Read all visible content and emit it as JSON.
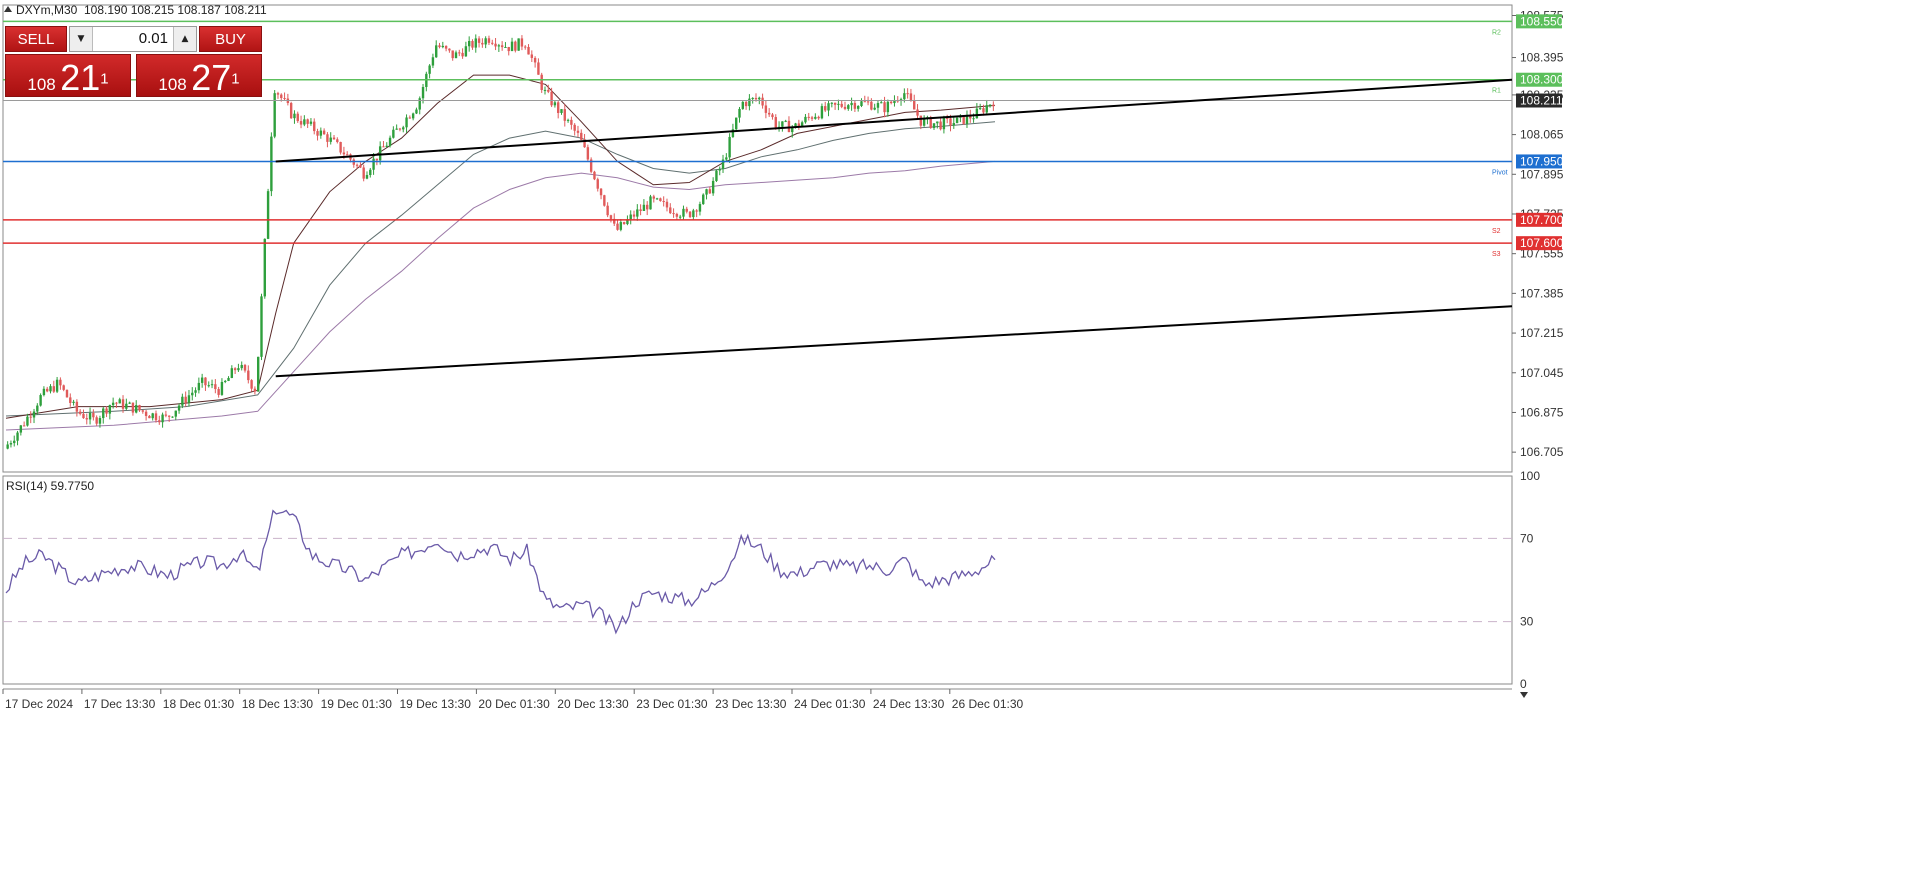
{
  "header": {
    "symbol_text": "DXYm,M30",
    "ohlc_text": "108.190 108.215 108.187 108.211"
  },
  "trade_panel": {
    "sell_label": "SELL",
    "buy_label": "BUY",
    "lot_value": "0.01",
    "sell_price": {
      "prefix": "108",
      "big": "21",
      "sup": "1"
    },
    "buy_price": {
      "prefix": "108",
      "big": "27",
      "sup": "1"
    }
  },
  "colors": {
    "bull": "#2e9f3c",
    "bear": "#e05a5a",
    "level_green": "#5cbf5c",
    "level_blue": "#1e6fd0",
    "level_red": "#e03030",
    "ma_dark": "#5a2a2a",
    "ma_gray": "#607070",
    "ma_purple": "#9c7aa8",
    "rsi_line": "#6a5aa8",
    "trend": "#000000"
  },
  "chart_data": [
    {
      "type": "candlestick",
      "symbol": "DXYm",
      "timeframe": "M30",
      "ylim": [
        106.62,
        108.62
      ],
      "y_ticks": [
        "108.575",
        "108.395",
        "108.235",
        "108.065",
        "107.895",
        "107.725",
        "107.555",
        "107.385",
        "107.215",
        "107.045",
        "106.875",
        "106.705"
      ],
      "x_ticks": [
        "17 Dec 2024",
        "17 Dec 13:30",
        "18 Dec 01:30",
        "18 Dec 13:30",
        "19 Dec 01:30",
        "19 Dec 13:30",
        "20 Dec 01:30",
        "20 Dec 13:30",
        "23 Dec 01:30",
        "23 Dec 13:30",
        "24 Dec 01:30",
        "24 Dec 13:30",
        "26 Dec 01:30"
      ],
      "price_path": [
        [
          0,
          106.72
        ],
        [
          1,
          106.82
        ],
        [
          2,
          106.94
        ],
        [
          3,
          107.0
        ],
        [
          4,
          106.88
        ],
        [
          5,
          106.84
        ],
        [
          6,
          106.92
        ],
        [
          7,
          106.9
        ],
        [
          8,
          106.87
        ],
        [
          9,
          106.85
        ],
        [
          10,
          106.93
        ],
        [
          11,
          107.0
        ],
        [
          12,
          106.97
        ],
        [
          13,
          107.08
        ],
        [
          14,
          106.97
        ],
        [
          15,
          108.27
        ],
        [
          16,
          108.15
        ],
        [
          17,
          108.1
        ],
        [
          18,
          108.05
        ],
        [
          19,
          107.98
        ],
        [
          20,
          107.9
        ],
        [
          21,
          108.0
        ],
        [
          22,
          108.1
        ],
        [
          23,
          108.2
        ],
        [
          24,
          108.45
        ],
        [
          25,
          108.4
        ],
        [
          26,
          108.45
        ],
        [
          27,
          108.48
        ],
        [
          28,
          108.44
        ],
        [
          29,
          108.46
        ],
        [
          30,
          108.25
        ],
        [
          31,
          108.15
        ],
        [
          32,
          108.05
        ],
        [
          33,
          107.85
        ],
        [
          34,
          107.65
        ],
        [
          35,
          107.72
        ],
        [
          36,
          107.78
        ],
        [
          37,
          107.75
        ],
        [
          38,
          107.72
        ],
        [
          39,
          107.8
        ],
        [
          40,
          107.95
        ],
        [
          41,
          108.2
        ],
        [
          42,
          108.22
        ],
        [
          43,
          108.1
        ],
        [
          44,
          108.1
        ],
        [
          45,
          108.15
        ],
        [
          46,
          108.18
        ],
        [
          47,
          108.2
        ],
        [
          48,
          108.2
        ],
        [
          49,
          108.18
        ],
        [
          50,
          108.25
        ],
        [
          51,
          108.12
        ],
        [
          52,
          108.11
        ],
        [
          53,
          108.12
        ],
        [
          54,
          108.15
        ],
        [
          55,
          108.211
        ]
      ],
      "ma_fast": [
        [
          0,
          106.85
        ],
        [
          4,
          106.9
        ],
        [
          8,
          106.9
        ],
        [
          12,
          106.93
        ],
        [
          14,
          106.97
        ],
        [
          15,
          107.3
        ],
        [
          16,
          107.6
        ],
        [
          18,
          107.82
        ],
        [
          20,
          107.95
        ],
        [
          22,
          108.05
        ],
        [
          24,
          108.2
        ],
        [
          26,
          108.32
        ],
        [
          28,
          108.32
        ],
        [
          30,
          108.28
        ],
        [
          32,
          108.12
        ],
        [
          34,
          107.95
        ],
        [
          36,
          107.85
        ],
        [
          38,
          107.86
        ],
        [
          40,
          107.95
        ],
        [
          42,
          108.0
        ],
        [
          44,
          108.07
        ],
        [
          46,
          108.1
        ],
        [
          48,
          108.13
        ],
        [
          50,
          108.16
        ],
        [
          52,
          108.17
        ],
        [
          55,
          108.19
        ]
      ],
      "ma_mid": [
        [
          0,
          106.86
        ],
        [
          6,
          106.88
        ],
        [
          10,
          106.9
        ],
        [
          14,
          106.95
        ],
        [
          16,
          107.15
        ],
        [
          18,
          107.42
        ],
        [
          20,
          107.6
        ],
        [
          22,
          107.72
        ],
        [
          24,
          107.85
        ],
        [
          26,
          107.98
        ],
        [
          28,
          108.05
        ],
        [
          30,
          108.08
        ],
        [
          32,
          108.05
        ],
        [
          34,
          107.98
        ],
        [
          36,
          107.92
        ],
        [
          38,
          107.9
        ],
        [
          40,
          107.92
        ],
        [
          42,
          107.97
        ],
        [
          44,
          108.0
        ],
        [
          46,
          108.04
        ],
        [
          48,
          108.07
        ],
        [
          50,
          108.09
        ],
        [
          52,
          108.1
        ],
        [
          55,
          108.12
        ]
      ],
      "ma_slow": [
        [
          0,
          106.8
        ],
        [
          6,
          106.82
        ],
        [
          12,
          106.86
        ],
        [
          14,
          106.88
        ],
        [
          16,
          107.05
        ],
        [
          18,
          107.22
        ],
        [
          20,
          107.36
        ],
        [
          22,
          107.48
        ],
        [
          24,
          107.62
        ],
        [
          26,
          107.75
        ],
        [
          28,
          107.83
        ],
        [
          30,
          107.88
        ],
        [
          32,
          107.9
        ],
        [
          34,
          107.88
        ],
        [
          36,
          107.84
        ],
        [
          38,
          107.83
        ],
        [
          40,
          107.85
        ],
        [
          42,
          107.86
        ],
        [
          44,
          107.87
        ],
        [
          46,
          107.88
        ],
        [
          48,
          107.9
        ],
        [
          50,
          107.91
        ],
        [
          52,
          107.93
        ],
        [
          55,
          107.95
        ]
      ],
      "levels": [
        {
          "name": "R2",
          "price": 108.55,
          "label": "108.550",
          "color": "#5cbf5c",
          "tag": "R2"
        },
        {
          "name": "R1",
          "price": 108.3,
          "label": "108.300",
          "color": "#5cbf5c",
          "tag": "R1"
        },
        {
          "name": "Current",
          "price": 108.211,
          "label": "108.211",
          "color": "#9a9a9a",
          "tag": ""
        },
        {
          "name": "Pivot",
          "price": 107.95,
          "label": "107.950",
          "color": "#1e6fd0",
          "tag": "Pivot"
        },
        {
          "name": "S2",
          "price": 107.7,
          "label": "107.700",
          "color": "#e03030",
          "tag": "S2"
        },
        {
          "name": "S3",
          "price": 107.6,
          "label": "107.600",
          "color": "#e03030",
          "tag": "S3"
        }
      ],
      "trendlines": [
        {
          "start": [
            15,
            107.95
          ],
          "end": [
            90,
            108.3
          ]
        },
        {
          "start": [
            15,
            107.03
          ],
          "end": [
            90,
            107.33
          ]
        }
      ]
    },
    {
      "type": "line",
      "title": "RSI(14) 59.7750",
      "ylim": [
        0,
        100
      ],
      "y_ticks": [
        "100",
        "70",
        "30",
        "0"
      ],
      "levels": [
        70,
        30
      ],
      "values": [
        [
          0,
          45
        ],
        [
          1,
          58
        ],
        [
          2,
          62
        ],
        [
          3,
          55
        ],
        [
          4,
          48
        ],
        [
          5,
          52
        ],
        [
          6,
          55
        ],
        [
          7,
          57
        ],
        [
          8,
          55
        ],
        [
          9,
          52
        ],
        [
          10,
          56
        ],
        [
          11,
          59
        ],
        [
          12,
          57
        ],
        [
          13,
          63
        ],
        [
          14,
          53
        ],
        [
          15,
          85
        ],
        [
          16,
          80
        ],
        [
          17,
          62
        ],
        [
          18,
          58
        ],
        [
          19,
          55
        ],
        [
          20,
          50
        ],
        [
          21,
          56
        ],
        [
          22,
          62
        ],
        [
          23,
          65
        ],
        [
          24,
          70
        ],
        [
          25,
          62
        ],
        [
          26,
          64
        ],
        [
          27,
          66
        ],
        [
          28,
          60
        ],
        [
          29,
          64
        ],
        [
          30,
          40
        ],
        [
          31,
          36
        ],
        [
          32,
          38
        ],
        [
          33,
          34
        ],
        [
          34,
          26
        ],
        [
          35,
          40
        ],
        [
          36,
          44
        ],
        [
          37,
          42
        ],
        [
          38,
          40
        ],
        [
          39,
          45
        ],
        [
          40,
          55
        ],
        [
          41,
          70
        ],
        [
          42,
          65
        ],
        [
          43,
          55
        ],
        [
          44,
          53
        ],
        [
          45,
          57
        ],
        [
          46,
          58
        ],
        [
          47,
          56
        ],
        [
          48,
          57
        ],
        [
          49,
          55
        ],
        [
          50,
          60
        ],
        [
          51,
          48
        ],
        [
          52,
          50
        ],
        [
          53,
          52
        ],
        [
          54,
          55
        ],
        [
          55,
          59.775
        ]
      ]
    }
  ]
}
